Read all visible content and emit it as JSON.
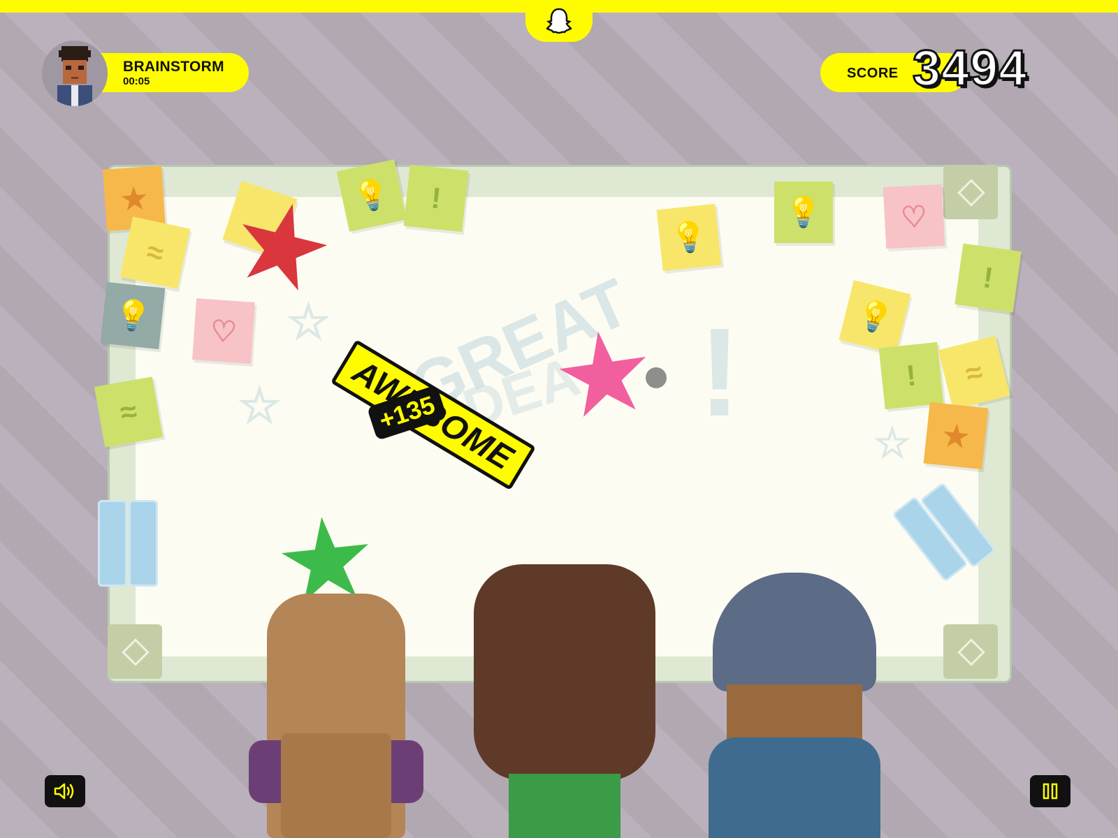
{
  "header": {
    "round_name": "BRAINSTORM",
    "timer": "00:05",
    "score_label": "SCORE",
    "score_value": "3494"
  },
  "feedback": {
    "banner": "AWESOME",
    "points": "+135"
  },
  "board": {
    "scribble_words": [
      "GREAT",
      "IDEA"
    ]
  },
  "icons": {
    "top": "snapchat-ghost-icon",
    "sound": "speaker-icon",
    "pause": "pause-icon"
  },
  "colors": {
    "brand_yellow": "#fffc00",
    "background": "#b7adb8",
    "board": "#fdfcf2",
    "star_red": "#d9363e",
    "star_pink": "#f25f9e",
    "star_green": "#3dbb4a"
  }
}
